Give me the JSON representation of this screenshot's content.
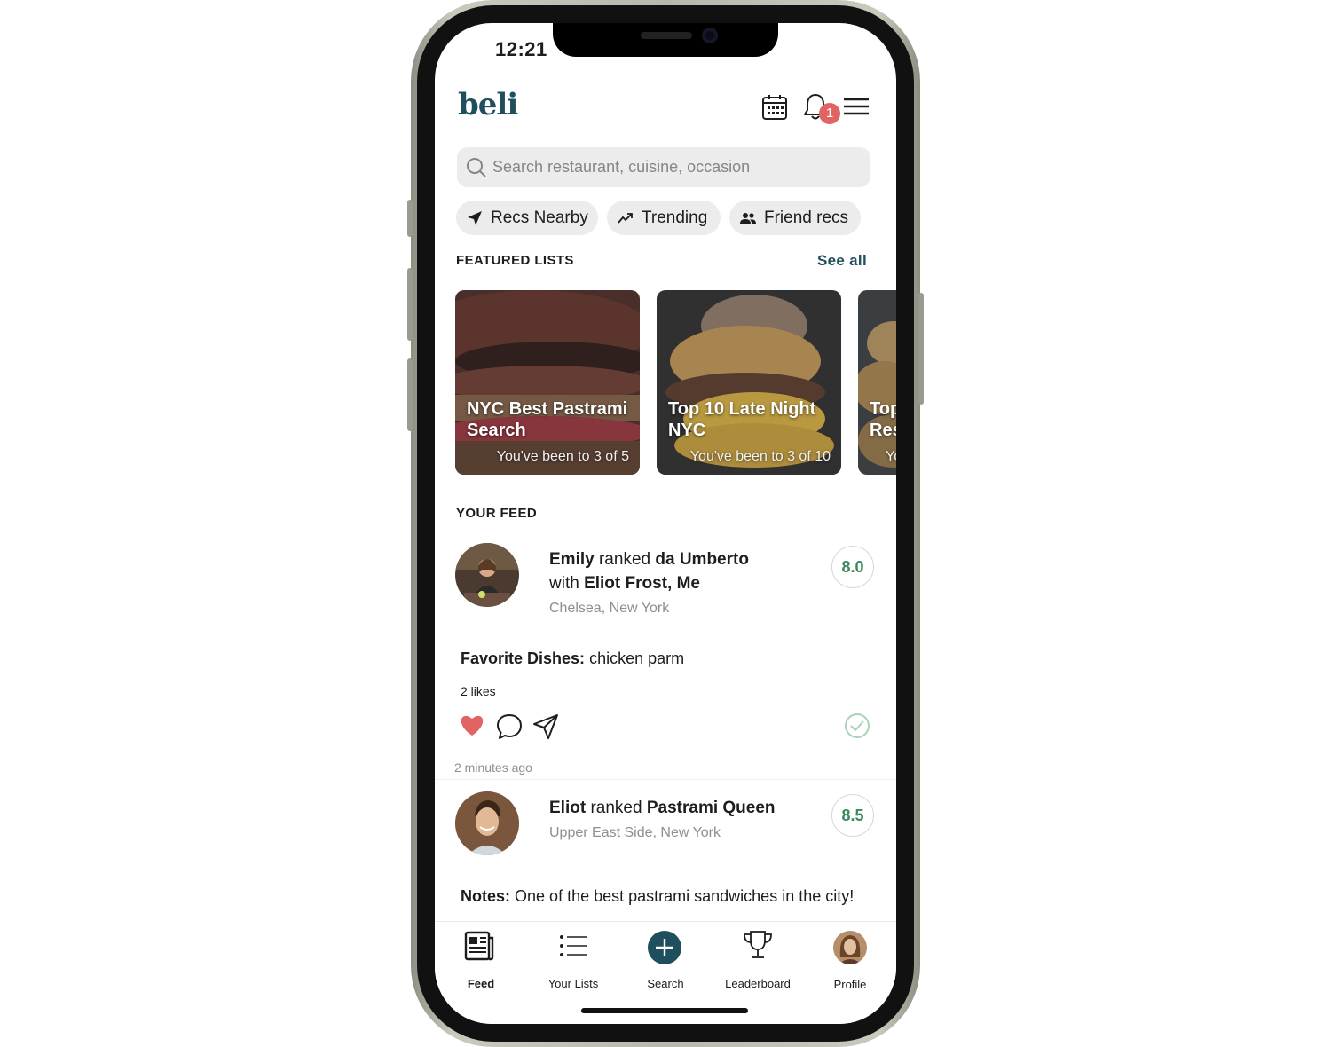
{
  "status_bar": {
    "time": "12:21"
  },
  "header": {
    "logo": "beli",
    "notification_count": "1",
    "icons": [
      "calendar-icon",
      "bell-icon",
      "menu-icon"
    ]
  },
  "search": {
    "placeholder": "Search restaurant, cuisine, occasion"
  },
  "chips": [
    {
      "label": "Recs Nearby",
      "icon": "location-arrow-icon"
    },
    {
      "label": "Trending",
      "icon": "trending-icon"
    },
    {
      "label": "Friend recs",
      "icon": "people-icon"
    }
  ],
  "featured": {
    "title": "FEATURED LISTS",
    "see_all": "See all",
    "lists": [
      {
        "title_line1": "NYC Best Pastrami",
        "title_line2": "Search",
        "subtitle": "You've been to 3 of 5"
      },
      {
        "title_line1": "Top 10 Late Night",
        "title_line2": "NYC",
        "subtitle": "You've been to 3 of 10"
      },
      {
        "title_line1": "Top",
        "title_line2": "Res",
        "subtitle": "Yo"
      }
    ]
  },
  "feed": {
    "title": "YOUR FEED",
    "posts": [
      {
        "user": "Emily",
        "verb": "ranked",
        "restaurant": "da Umberto",
        "with_prefix": "with",
        "with": "Eliot Frost, Me",
        "location": "Chelsea, New York",
        "score": "8.0",
        "detail_label": "Favorite Dishes:",
        "detail_text": "chicken parm",
        "likes": "2 likes",
        "time": "2 minutes ago"
      },
      {
        "user": "Eliot",
        "verb": "ranked",
        "restaurant": "Pastrami Queen",
        "location": "Upper East Side, New York",
        "score": "8.5",
        "detail_label": "Notes:",
        "detail_text": "One of the best pastrami sandwiches in the city!"
      }
    ]
  },
  "tabbar": {
    "tabs": [
      {
        "label": "Feed",
        "icon": "newspaper-icon",
        "active": true
      },
      {
        "label": "Your Lists",
        "icon": "list-icon"
      },
      {
        "label": "Search",
        "icon": "plus-circle-icon"
      },
      {
        "label": "Leaderboard",
        "icon": "trophy-icon"
      },
      {
        "label": "Profile",
        "icon": "avatar"
      }
    ]
  },
  "colors": {
    "brand": "#1f4f5c",
    "heart": "#e06462",
    "score": "#3b8a5e",
    "badge": "#e06462"
  }
}
